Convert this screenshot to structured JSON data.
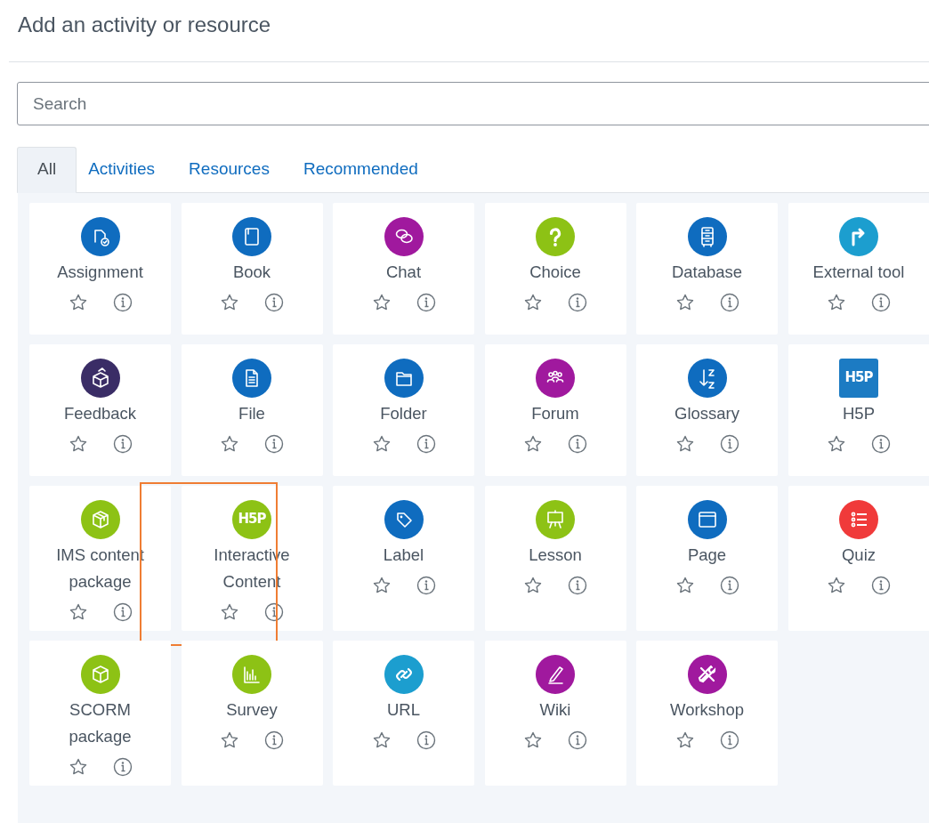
{
  "dialog": {
    "title": "Add an activity or resource"
  },
  "search": {
    "placeholder": "Search"
  },
  "tabs": [
    {
      "label": "All",
      "selected": true
    },
    {
      "label": "Activities",
      "selected": false
    },
    {
      "label": "Resources",
      "selected": false
    },
    {
      "label": "Recommended",
      "selected": false
    }
  ],
  "items": [
    {
      "name": "Assignment",
      "kind": "circle",
      "color": "#0f6cbf",
      "starred": false,
      "highlighted": false
    },
    {
      "name": "Book",
      "kind": "circle",
      "color": "#0f6cbf",
      "starred": false,
      "highlighted": false
    },
    {
      "name": "Chat",
      "kind": "circle",
      "color": "#a0199e",
      "starred": false,
      "highlighted": false
    },
    {
      "name": "Choice",
      "kind": "circle",
      "color": "#8dc215",
      "starred": false,
      "highlighted": false
    },
    {
      "name": "Database",
      "kind": "circle",
      "color": "#0f6cbf",
      "starred": false,
      "highlighted": false
    },
    {
      "name": "External tool",
      "kind": "circle",
      "color": "#1c9ecf",
      "starred": false,
      "highlighted": false
    },
    {
      "name": "Feedback",
      "kind": "circle",
      "color": "#3a2d66",
      "starred": false,
      "highlighted": false
    },
    {
      "name": "File",
      "kind": "circle",
      "color": "#0f6cbf",
      "starred": false,
      "highlighted": false
    },
    {
      "name": "Folder",
      "kind": "circle",
      "color": "#0f6cbf",
      "starred": false,
      "highlighted": false
    },
    {
      "name": "Forum",
      "kind": "circle",
      "color": "#a0199e",
      "starred": false,
      "highlighted": false
    },
    {
      "name": "Glossary",
      "kind": "circle",
      "color": "#0f6cbf",
      "starred": false,
      "highlighted": false
    },
    {
      "name": "H5P",
      "kind": "logo",
      "logo_text": "H5P",
      "color": "#1c7bc3",
      "starred": false,
      "highlighted": false
    },
    {
      "name": "IMS content package",
      "kind": "circle",
      "color": "#8dc215",
      "starred": false,
      "highlighted": false
    },
    {
      "name": "Interactive Content",
      "kind": "logo-circle",
      "logo_text": "H5P",
      "color": "#8dc215",
      "starred": false,
      "highlighted": true
    },
    {
      "name": "Label",
      "kind": "circle",
      "color": "#0f6cbf",
      "starred": false,
      "highlighted": false
    },
    {
      "name": "Lesson",
      "kind": "circle",
      "color": "#8dc215",
      "starred": false,
      "highlighted": false
    },
    {
      "name": "Page",
      "kind": "circle",
      "color": "#0f6cbf",
      "starred": false,
      "highlighted": false
    },
    {
      "name": "Quiz",
      "kind": "circle",
      "color": "#f03a3a",
      "starred": false,
      "highlighted": false
    },
    {
      "name": "SCORM package",
      "kind": "circle",
      "color": "#8dc215",
      "starred": false,
      "highlighted": false
    },
    {
      "name": "Survey",
      "kind": "circle",
      "color": "#8dc215",
      "starred": false,
      "highlighted": false
    },
    {
      "name": "URL",
      "kind": "circle",
      "color": "#1c9ecf",
      "starred": false,
      "highlighted": false
    },
    {
      "name": "Wiki",
      "kind": "circle",
      "color": "#a0199e",
      "starred": false,
      "highlighted": false
    },
    {
      "name": "Workshop",
      "kind": "circle",
      "color": "#a0199e",
      "starred": false,
      "highlighted": false
    }
  ]
}
